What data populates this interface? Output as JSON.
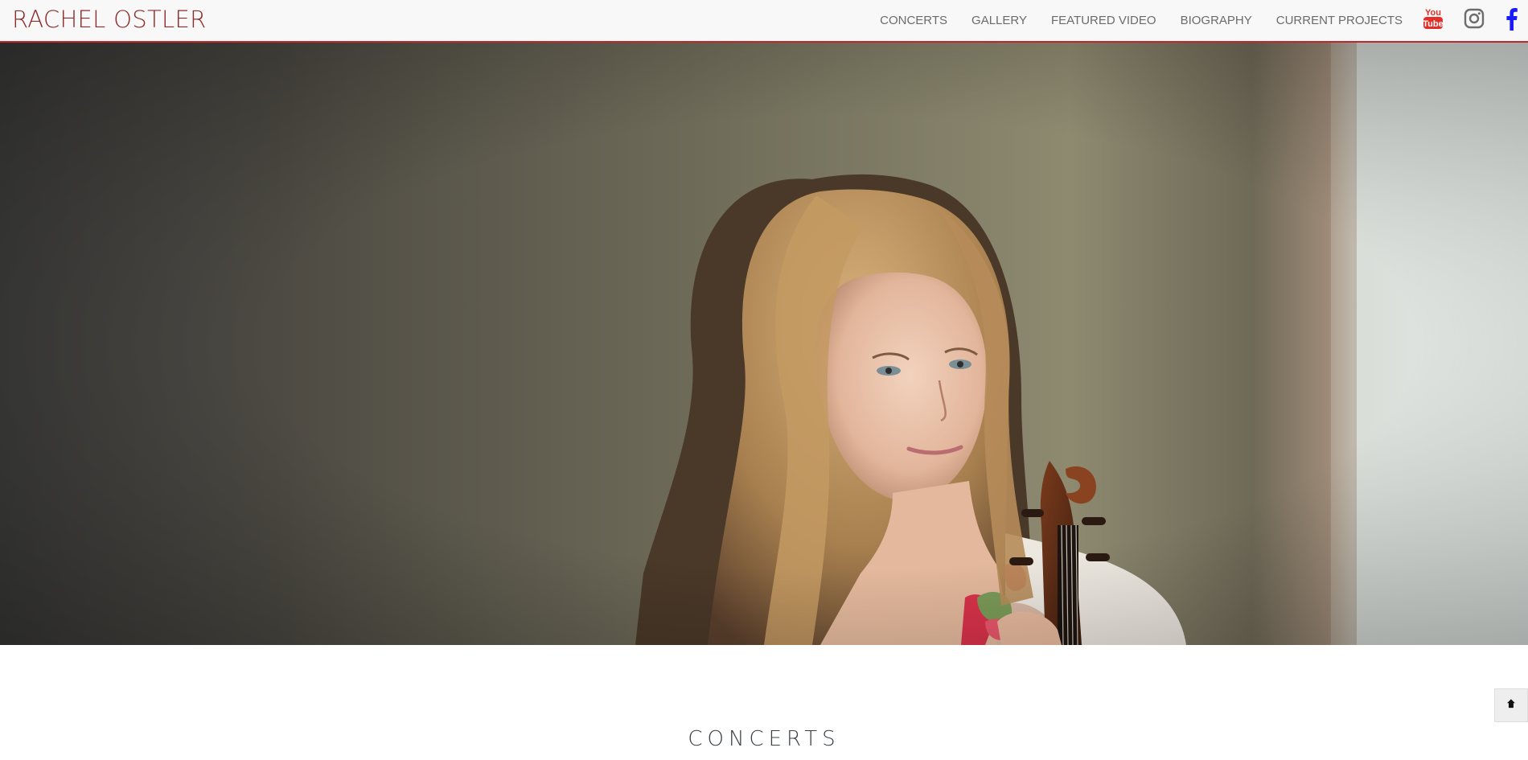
{
  "brand": {
    "name": "RACHEL OSTLER"
  },
  "nav": {
    "items": [
      {
        "label": "CONCERTS"
      },
      {
        "label": "GALLERY"
      },
      {
        "label": "FEATURED VIDEO"
      },
      {
        "label": "BIOGRAPHY"
      },
      {
        "label": "CURRENT PROJECTS"
      }
    ],
    "social": [
      {
        "icon": "youtube-icon",
        "color": "#e52d27"
      },
      {
        "icon": "instagram-icon",
        "color": "#6d6d6d"
      },
      {
        "icon": "facebook-icon",
        "color": "#1a1aff"
      }
    ]
  },
  "hero": {
    "subject": "woman with violin portrait"
  },
  "sections": {
    "concerts_title": "CONCERTS"
  },
  "colors": {
    "accent": "#c0272d",
    "brand_text": "#8e2b2b",
    "nav_text": "#6b6b6b"
  }
}
